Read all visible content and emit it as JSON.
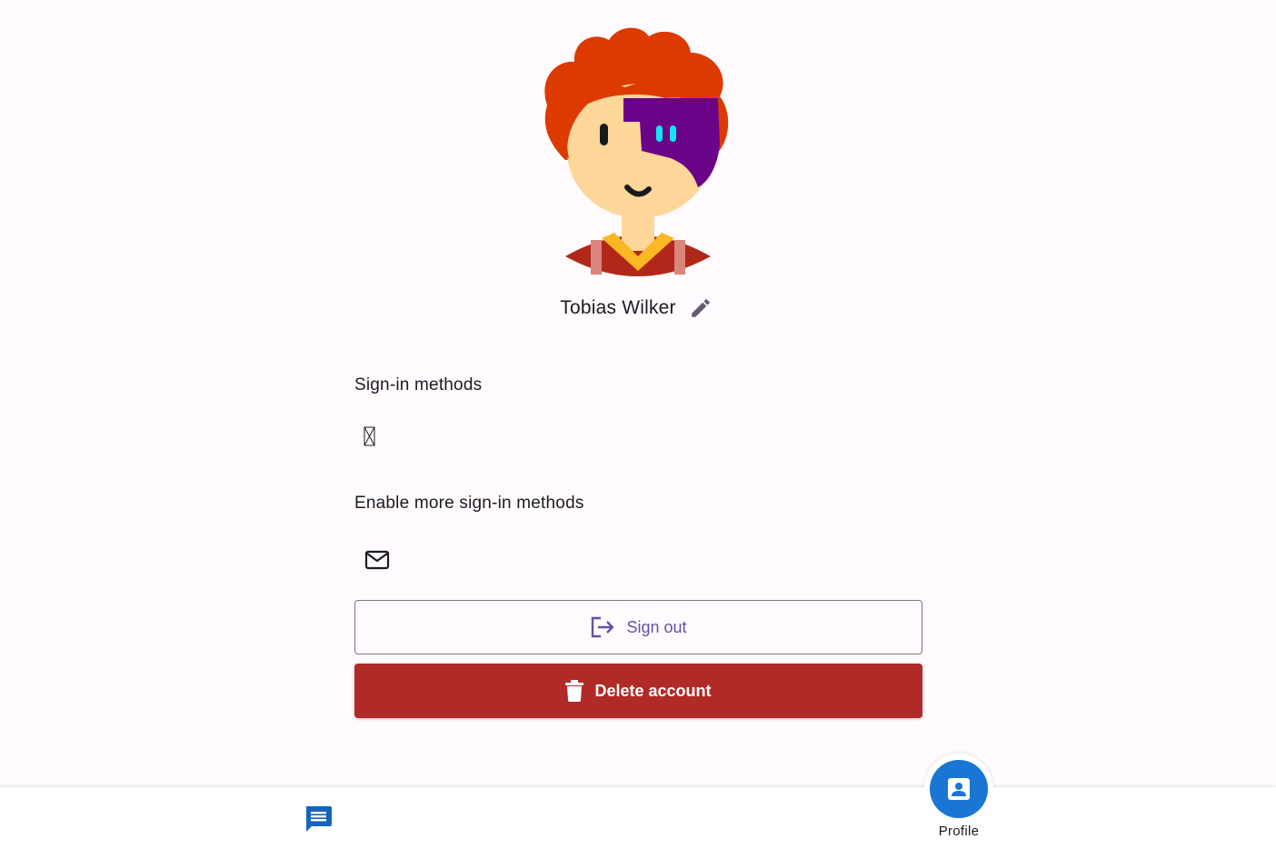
{
  "profile": {
    "name": "Tobias Wilker",
    "avatar_icon": "cartoon-avatar",
    "edit_icon": "pencil-icon"
  },
  "sections": {
    "sign_in_methods_title": "Sign-in methods",
    "sign_in_method_icon": "missing-glyph-icon",
    "enable_more_title": "Enable more sign-in methods",
    "enable_more_icon": "mail-icon"
  },
  "actions": {
    "sign_out_label": "Sign out",
    "sign_out_icon": "logout-icon",
    "delete_label": "Delete account",
    "delete_icon": "trash-icon"
  },
  "bottom_nav": {
    "chat_icon": "chat-icon",
    "profile_icon": "contact-card-icon",
    "profile_label": "Profile"
  },
  "colors": {
    "background": "#fffbfe",
    "primary": "#6750a4",
    "danger": "#b02a27",
    "nav_active": "#1976d2",
    "chat_icon": "#1565c0"
  }
}
